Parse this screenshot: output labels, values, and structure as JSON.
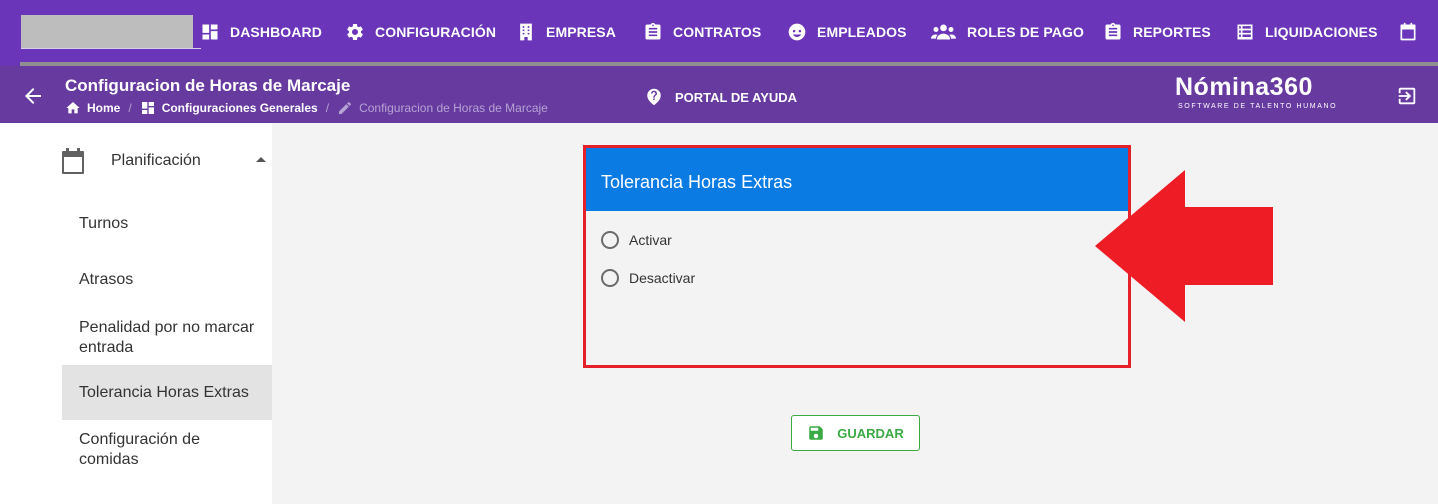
{
  "colors": {
    "nav_bg": "#6a35b8",
    "header_bg": "#673aa0",
    "card_header": "#0a7be3",
    "highlight_border": "#e4202a",
    "arrow": "#ee1c25",
    "save_green": "#3caa44",
    "sidebar_active": "#e3e3e3"
  },
  "topnav": {
    "items": [
      {
        "label": "DASHBOARD",
        "icon": "dashboard-icon"
      },
      {
        "label": "CONFIGURACIÓN",
        "icon": "gear-icon"
      },
      {
        "label": "EMPRESA",
        "icon": "building-icon"
      },
      {
        "label": "CONTRATOS",
        "icon": "clipboard-icon"
      },
      {
        "label": "EMPLEADOS",
        "icon": "face-icon"
      },
      {
        "label": "ROLES DE PAGO",
        "icon": "people-icon"
      },
      {
        "label": "REPORTES",
        "icon": "report-icon"
      },
      {
        "label": "LIQUIDACIONES",
        "icon": "list-icon"
      },
      {
        "label": "",
        "icon": "calendar-icon"
      }
    ]
  },
  "header": {
    "title": "Configuracion de Horas de Marcaje",
    "breadcrumb": [
      {
        "label": "Home",
        "icon": "home-icon"
      },
      {
        "label": "Configuraciones Generales",
        "icon": "dashboard-icon"
      },
      {
        "label": "Configuracion de Horas de Marcaje",
        "icon": "pencil-icon"
      }
    ],
    "help_label": "PORTAL DE AYUDA",
    "brand_name": "Nómina360",
    "brand_tagline": "SOFTWARE DE TALENTO HUMANO"
  },
  "sidebar": {
    "section_label": "Planificación",
    "section_icon": "calendar-icon",
    "items": [
      {
        "label": "Turnos",
        "active": false
      },
      {
        "label": "Atrasos",
        "active": false
      },
      {
        "label": "Penalidad por no marcar entrada",
        "active": false
      },
      {
        "label": "Tolerancia Horas Extras",
        "active": true
      },
      {
        "label": "Configuración de comidas",
        "active": false
      }
    ]
  },
  "card": {
    "title": "Tolerancia Horas Extras",
    "options": [
      {
        "label": "Activar",
        "selected": false
      },
      {
        "label": "Desactivar",
        "selected": false
      }
    ]
  },
  "save_button": {
    "label": "GUARDAR",
    "icon": "save-icon"
  }
}
